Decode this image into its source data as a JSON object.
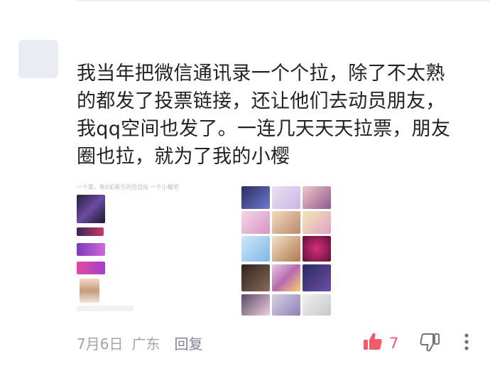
{
  "comment": {
    "text": "我当年把微信通讯录一个个拉，除了不太熟\n的都发了投票链接，还让他们去动员朋友，\n我qq空间也发了。一连几天天天拉票，朋友\n圈也拉，就为了我的小樱"
  },
  "images": {
    "left_caption": "一个票，有6如黑号的百位投 一个小樱吧"
  },
  "footer": {
    "date": "7月6日",
    "location": "广东",
    "reply_label": "回复",
    "like_count": "7"
  },
  "icons": {
    "like": "thumbs-up-icon",
    "dislike": "thumbs-down-icon",
    "more": "more-vertical-icon"
  },
  "colors": {
    "like_accent": "#ef5b6b",
    "meta_gray": "#9ea3ad"
  }
}
